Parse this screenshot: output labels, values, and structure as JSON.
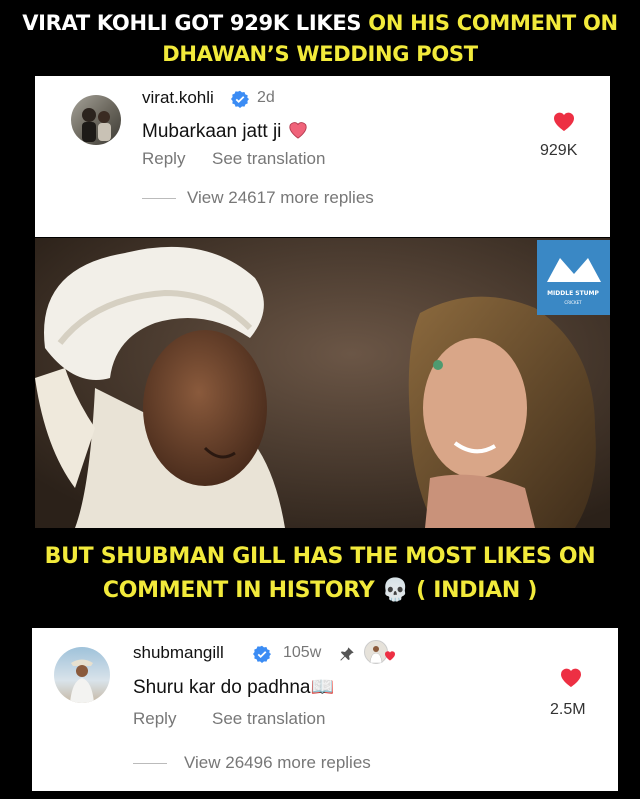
{
  "top_headline": {
    "part_white": "VIRAT KOHLI GOT 929K LIKES ",
    "part_yellow_1": "ON HIS COMMENT ON",
    "part_yellow_2": "DHAWAN’S WEDDING POST"
  },
  "comment1": {
    "username": "virat.kohli",
    "time": "2d",
    "text": "Mubarkaan jatt ji",
    "emoji": "heart",
    "reply_label": "Reply",
    "translate_label": "See translation",
    "like_count": "929K",
    "view_replies": "View 24617 more replies"
  },
  "photo": {
    "watermark": "MIDDLE STUMP",
    "watermark_sub": "CRICKET"
  },
  "mid_headline": {
    "line1": "BUT SHUBMAN GILL HAS THE MOST LIKES ON",
    "line2a": "COMMENT IN HISTORY",
    "emoji": "💀",
    "line2b": "( INDIAN )"
  },
  "comment2": {
    "username": "shubmangill",
    "time": "105w",
    "text": "Shuru kar do padhna",
    "emoji": "📖",
    "reply_label": "Reply",
    "translate_label": "See translation",
    "like_count": "2.5M",
    "view_replies": "View 26496 more replies"
  },
  "colors": {
    "accent_yellow": "#f2ea3b",
    "like_red": "#ed2f43",
    "verified_blue": "#3b8cf4"
  },
  "icons": [
    "verified-icon",
    "heart-icon",
    "pin-icon",
    "skull-emoji",
    "book-emoji"
  ]
}
